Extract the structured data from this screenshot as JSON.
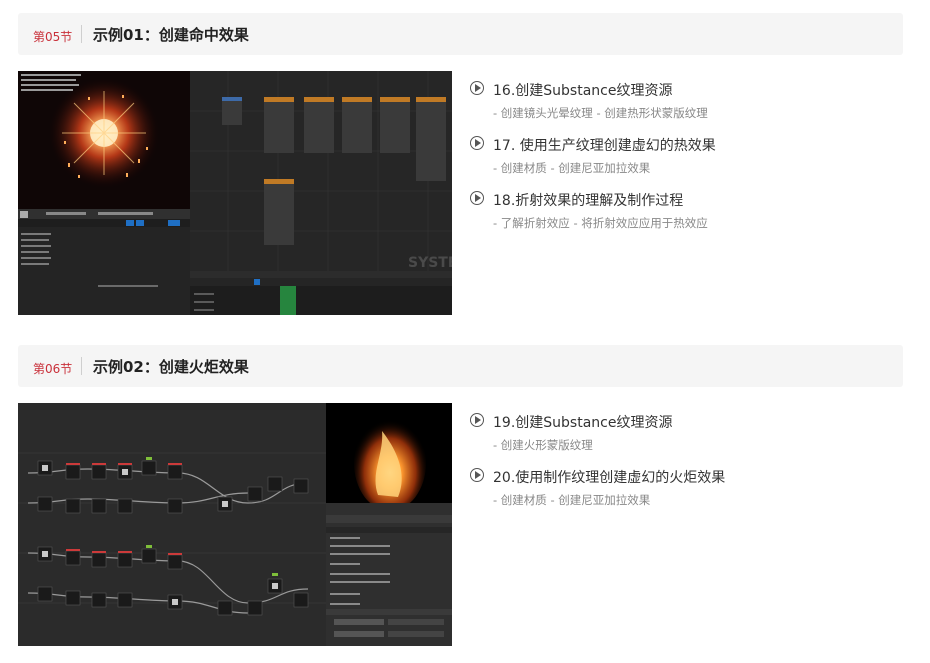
{
  "sections": [
    {
      "number": "第05节",
      "title": "示例01：创建命中效果",
      "thumbnail_text": "SYSTEM",
      "thumbnail_hint": "Enter a value on the left to begin editing",
      "lessons": [
        {
          "title": "16.创建Substance纹理资源",
          "subtitle": "- 创建镜头光晕纹理 - 创建热形状蒙版纹理"
        },
        {
          "title": "17. 使用生产纹理创建虚幻的热效果",
          "subtitle": "- 创建材质 - 创建尼亚加拉效果"
        },
        {
          "title": "18.折射效果的理解及制作过程",
          "subtitle": "- 了解折射效应 - 将折射效应应用于热效应"
        }
      ]
    },
    {
      "number": "第06节",
      "title": "示例02：创建火炬效果",
      "lessons": [
        {
          "title": "19.创建Substance纹理资源",
          "subtitle": "- 创建火形蒙版纹理"
        },
        {
          "title": "20.使用制作纹理创建虚幻的火炬效果",
          "subtitle": "- 创建材质 - 创建尼亚加拉效果"
        }
      ]
    }
  ],
  "colors": {
    "accent": "#c9303a",
    "header_bg": "#f5f5f5",
    "title_text": "#222222",
    "subtitle_text": "#888888"
  },
  "icons": {
    "lesson_marker": "play-circle-icon"
  }
}
